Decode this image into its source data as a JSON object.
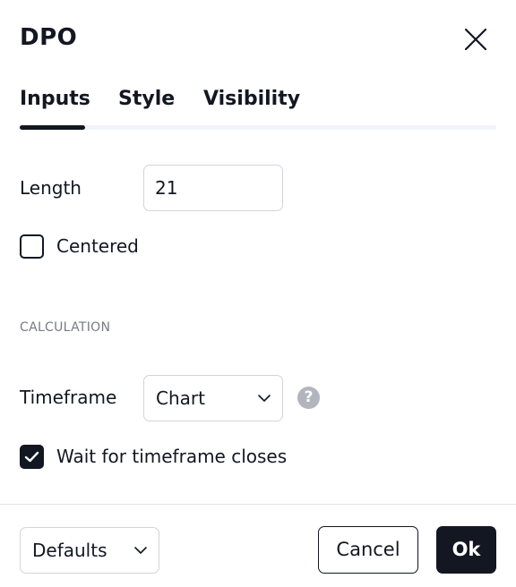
{
  "dialog": {
    "title": "DPO"
  },
  "tabs": [
    {
      "label": "Inputs",
      "active": true
    },
    {
      "label": "Style",
      "active": false
    },
    {
      "label": "Visibility",
      "active": false
    }
  ],
  "inputs": {
    "length_label": "Length",
    "length_value": "21",
    "centered_label": "Centered",
    "centered_checked": false,
    "section_calculation": "CALCULATION",
    "timeframe_label": "Timeframe",
    "timeframe_value": "Chart",
    "wait_label": "Wait for timeframe closes",
    "wait_checked": true,
    "help_glyph": "?"
  },
  "footer": {
    "defaults_label": "Defaults",
    "cancel_label": "Cancel",
    "ok_label": "Ok"
  },
  "colors": {
    "text": "#131722",
    "muted": "#787b86",
    "border": "#d1d4dc",
    "primary_button": "#131722",
    "help_icon": "#b2b5be"
  },
  "icons": {
    "close": "close-icon",
    "chevron": "chevron-down-icon",
    "check": "checkmark-icon",
    "help": "question-circle-icon"
  }
}
